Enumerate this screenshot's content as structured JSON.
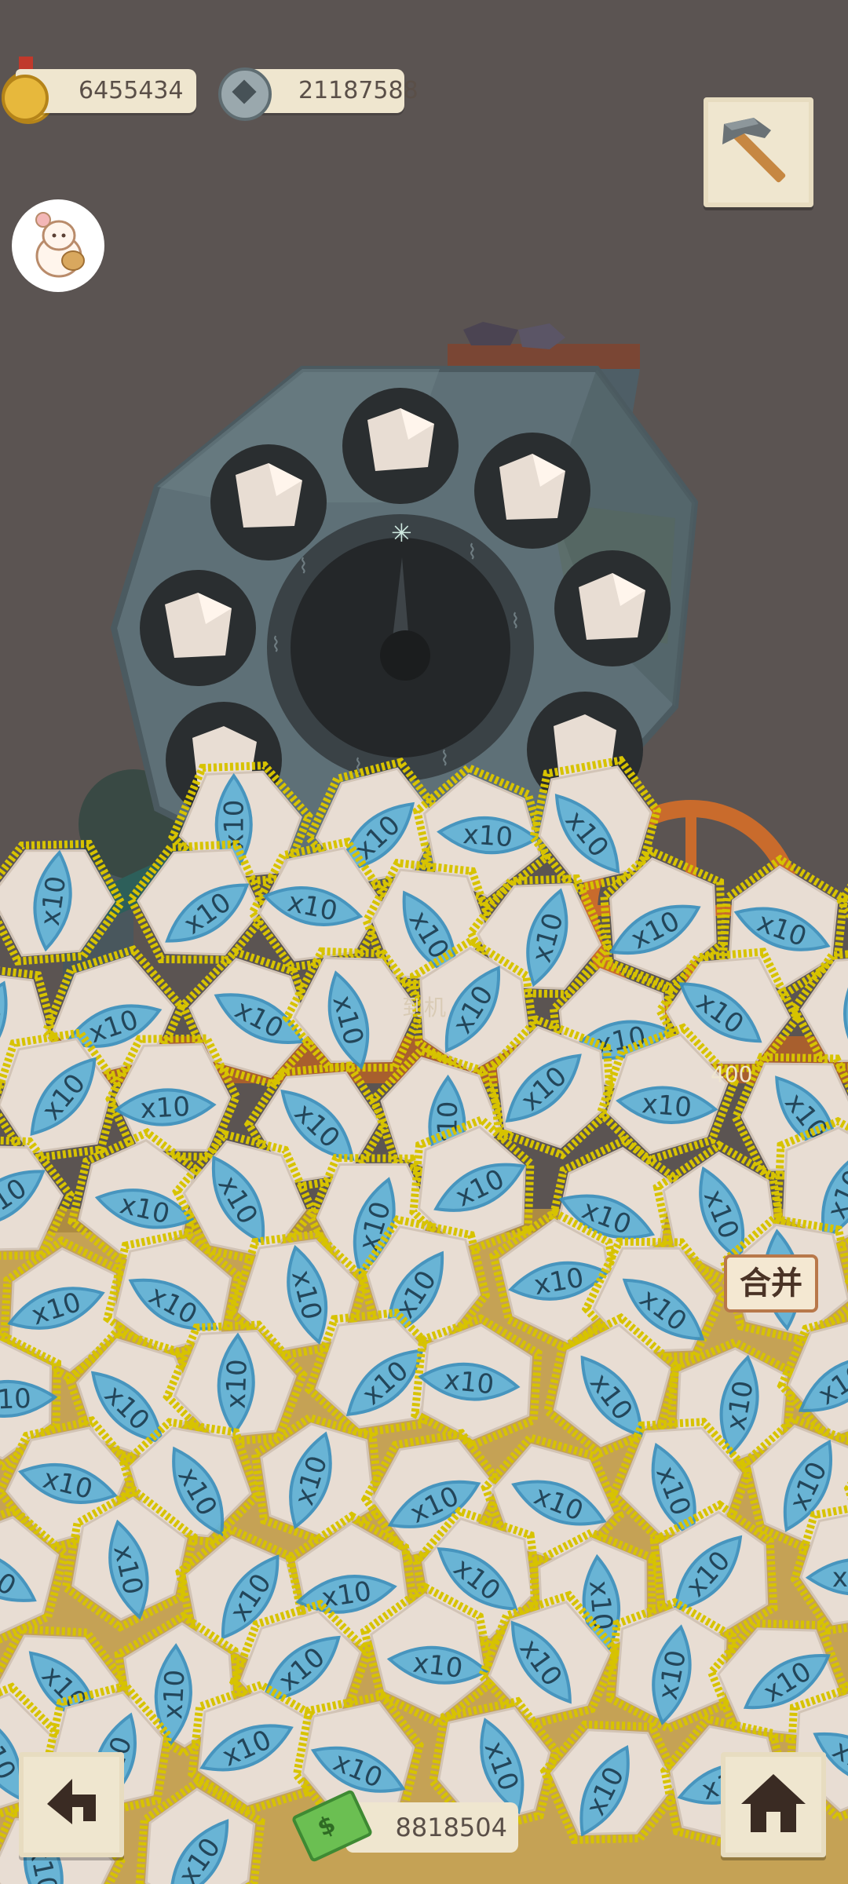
{
  "hud": {
    "gold_coins": "6455434",
    "silver_coins": "21187588",
    "cash": "8818504"
  },
  "buttons": {
    "merge_label": "合并"
  },
  "machine": {
    "buried_label": "到机",
    "buried_number": "400"
  },
  "item_tokens": {
    "multiplier": "x10",
    "visible_count": 86
  },
  "icons": {
    "gold_coin": "gold-coin-icon",
    "silver_coin": "silver-coin-icon",
    "pickaxe": "pickaxe-icon",
    "avatar": "rabbit-avatar-icon",
    "back": "back-arrow-icon",
    "home": "home-icon",
    "cash": "cash-icon"
  },
  "colors": {
    "background": "#5b5452",
    "token_blue": "#5fb1d6",
    "token_outline": "#3a8fbd",
    "glow_yellow": "#d7c300",
    "rock": "#e8ddd3",
    "machine_slate": "#55676d",
    "orange_wheel": "#c96b2c"
  }
}
